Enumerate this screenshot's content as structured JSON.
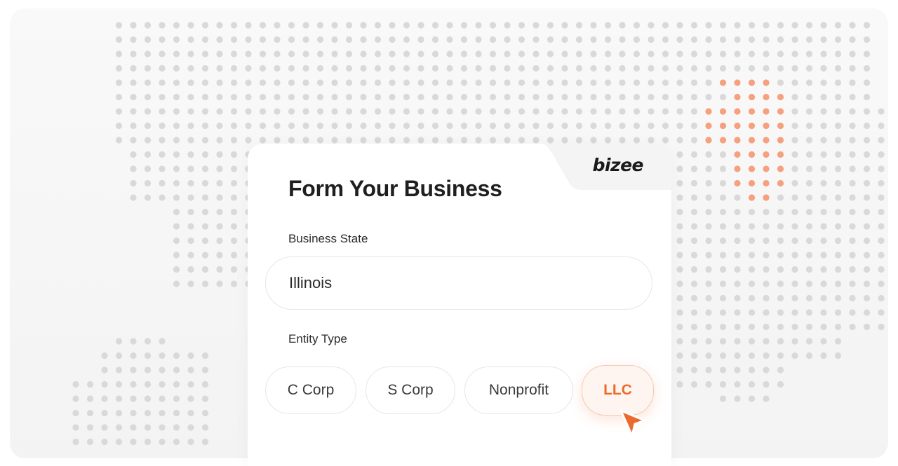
{
  "brand": {
    "name": "bizee"
  },
  "form": {
    "title": "Form Your Business",
    "state_label": "Business State",
    "state_value": "Illinois",
    "entity_label": "Entity Type",
    "entity_options": [
      "C Corp",
      "S Corp",
      "Nonprofit",
      "LLC"
    ],
    "selected_entity": "LLC"
  },
  "colors": {
    "accent": "#ee6a2c",
    "map_dot": "#d9d9d9",
    "map_highlight": "#f5a07e"
  },
  "icons": {
    "cursor": "pointer-cursor-icon"
  }
}
